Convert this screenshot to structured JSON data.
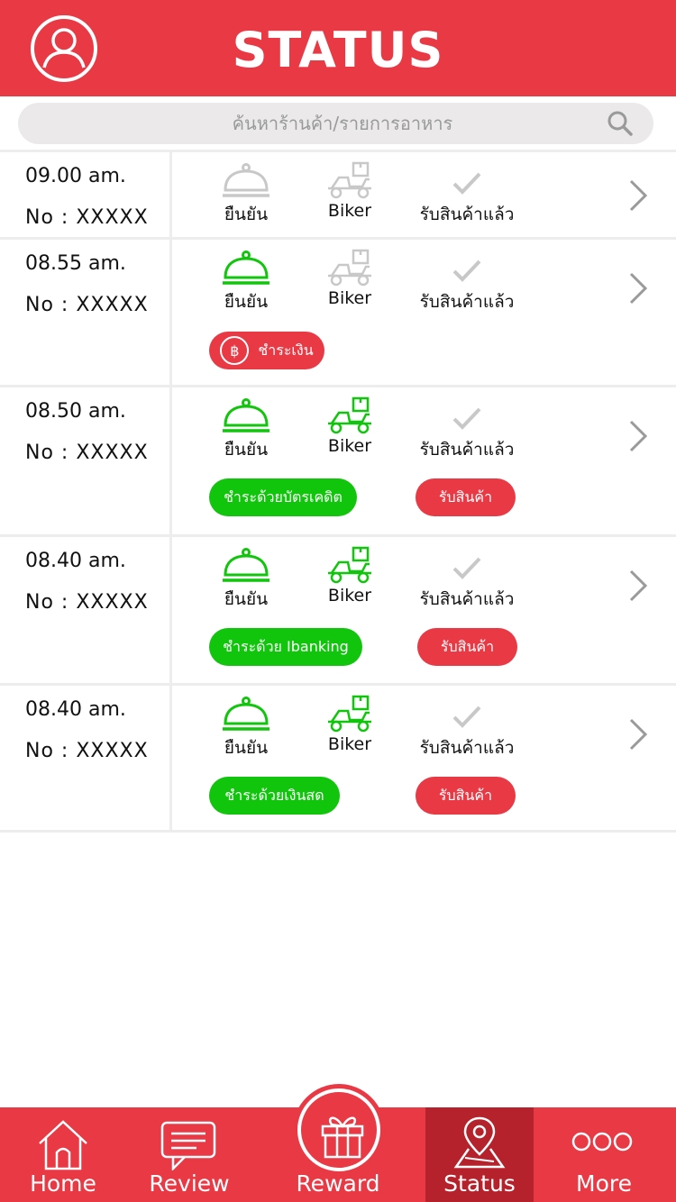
{
  "header": {
    "title": "STATUS",
    "avatar_icon": "user-circle-icon"
  },
  "search": {
    "placeholder": "ค้นหาร้านค้า/รายการอาหาร",
    "icon": "search-icon"
  },
  "steps": {
    "confirm": "ยืนยัน",
    "biker": "Biker",
    "received": "รับสินค้าแล้ว"
  },
  "orders": [
    {
      "time": "09.00 am.",
      "no": "No : XXXXX",
      "confirm_active": false,
      "biker_active": false
    },
    {
      "time": "08.55 am.",
      "no": "No : XXXXX",
      "confirm_active": true,
      "biker_active": false,
      "pay_label": "ชำระเงิน",
      "pay_icon": "฿"
    },
    {
      "time": "08.50 am.",
      "no": "No : XXXXX",
      "confirm_active": true,
      "biker_active": true,
      "pay_label": "ชำระด้วยบัตรเคดิต",
      "receive_label": "รับสินค้า"
    },
    {
      "time": "08.40 am.",
      "no": "No : XXXXX",
      "confirm_active": true,
      "biker_active": true,
      "pay_label": "ชำระด้วย Ibanking",
      "receive_label": "รับสินค้า"
    },
    {
      "time": "08.40 am.",
      "no": "No : XXXXX",
      "confirm_active": true,
      "biker_active": true,
      "pay_label": "ชำระด้วยเงินสด",
      "receive_label": "รับสินค้า"
    }
  ],
  "colors": {
    "brand_red": "#e83945",
    "active_green": "#11c50d",
    "inactive_gray": "#c8c8c8",
    "nav_active": "#b5222c"
  },
  "nav": {
    "items": [
      {
        "label": "Home",
        "icon": "home-icon"
      },
      {
        "label": "Review",
        "icon": "chat-icon"
      },
      {
        "label": "Reward",
        "icon": "gift-icon"
      },
      {
        "label": "Status",
        "icon": "map-pin-icon",
        "active": true
      },
      {
        "label": "More",
        "icon": "more-dots-icon"
      }
    ]
  }
}
